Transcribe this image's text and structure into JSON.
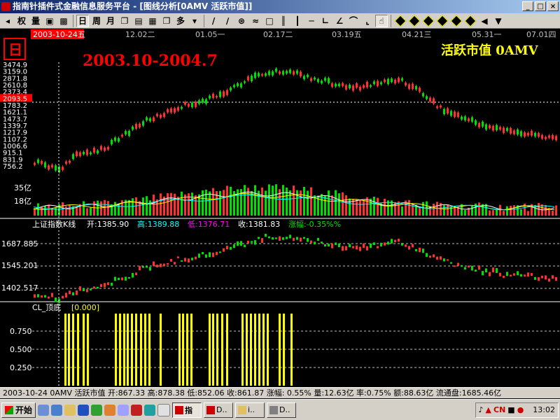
{
  "window": {
    "title": "指南针插件式金融信息服务平台 - [图线分析[0AMV 活跃市值]]",
    "minimize": "_",
    "maximize": "□",
    "close": "×"
  },
  "toolbar": {
    "items": [
      "权",
      "量",
      "日",
      "周",
      "月",
      "多"
    ]
  },
  "chart": {
    "date_box": "2003-10-24五",
    "period_icon": "日",
    "range_label": "2003.10-2004.7",
    "name_label": "活跃市值 0AMV",
    "date_ticks": [
      "12.02二",
      "01.05一",
      "02.17二",
      "03.19五",
      "04.21三",
      "05.31一",
      "07.01四"
    ],
    "price_ticks": [
      "3474.9",
      "3159.0",
      "2871.8",
      "2610.8",
      "2373.4",
      "2093.5",
      "1783.2",
      "1621.1",
      "1473.7",
      "1339.7",
      "1217.9",
      "1107.2",
      "1006.6",
      "915.1",
      "831.9",
      "756.2"
    ],
    "price_highlight": "2093.5",
    "volume_ticks": [
      "35亿",
      "18亿"
    ],
    "index_panel": {
      "name": "上证指数K线",
      "open_label": "开:1385.90",
      "high_label": "高:1389.88",
      "low_label": "低:1376.71",
      "close_label": "收:1381.83",
      "change_label": "涨幅:-0.35%%",
      "ticks": [
        "1687.885",
        "1545.201",
        "1402.517"
      ]
    },
    "cl_panel": {
      "name": "CL_顶底",
      "value": "[0.000]",
      "ticks": [
        "0.750",
        "0.500",
        "0.250"
      ]
    }
  },
  "colors": {
    "up": "#ff3030",
    "down": "#00e000",
    "grid": "#c0c0c0",
    "label_red": "#ff0000",
    "label_yellow": "#ffff00",
    "bar_yellow": "#ffff00",
    "title_blue": "#0a246a"
  },
  "status": "2003-10-24  0AMV  活跃市值  开:867.33  高:878.38  低:852.06  收:861.87  涨幅: 0.55%  量:12.63亿  率:0.75%  额:88.63亿  流通盘:1685.46亿",
  "taskbar": {
    "start": "开始",
    "tasks": [
      "指",
      "D..",
      "i..",
      "D.."
    ],
    "clock": "13:02",
    "ime": "CN"
  }
}
